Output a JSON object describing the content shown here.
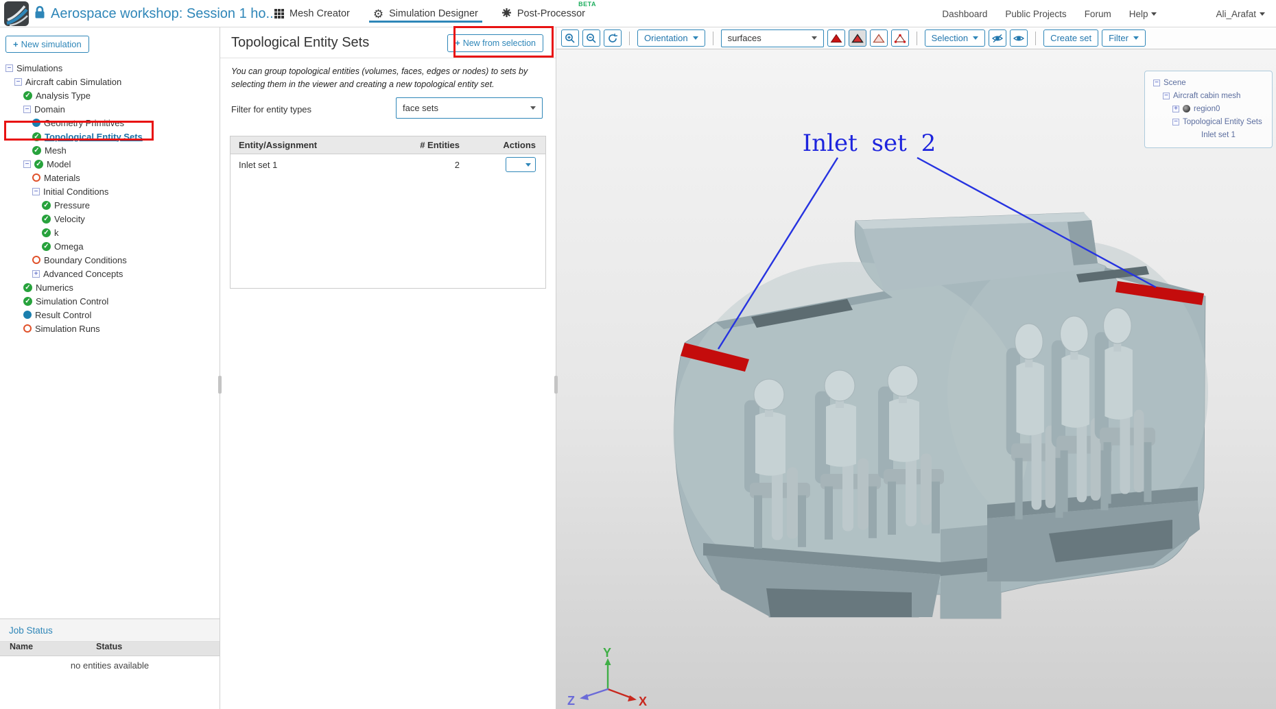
{
  "header": {
    "title": "Aerospace workshop: Session 1 ho...",
    "tabs": [
      {
        "label": "Mesh Creator"
      },
      {
        "label": "Simulation Designer"
      },
      {
        "label": "Post-Processor",
        "badge": "BETA"
      }
    ],
    "links": {
      "dashboard": "Dashboard",
      "public_projects": "Public Projects",
      "forum": "Forum",
      "help": "Help",
      "user": "Ali_Arafat"
    }
  },
  "sidebar": {
    "new_simulation": "New simulation",
    "tree": [
      {
        "label": "Simulations",
        "icon": "none",
        "twisty": "minus"
      },
      {
        "label": "Aircraft cabin Simulation",
        "icon": "none",
        "twisty": "minus"
      },
      {
        "label": "Analysis Type",
        "icon": "check",
        "twisty": "none"
      },
      {
        "label": "Domain",
        "icon": "none",
        "twisty": "minus"
      },
      {
        "label": "Geometry Primitives",
        "icon": "dot",
        "twisty": "none"
      },
      {
        "label": "Topological Entity Sets",
        "icon": "check",
        "twisty": "none"
      },
      {
        "label": "Mesh",
        "icon": "check",
        "twisty": "none"
      },
      {
        "label": "Model",
        "icon": "check",
        "twisty": "minus"
      },
      {
        "label": "Materials",
        "icon": "ring",
        "twisty": "none"
      },
      {
        "label": "Initial Conditions",
        "icon": "none",
        "twisty": "minus"
      },
      {
        "label": "Pressure",
        "icon": "check",
        "twisty": "none"
      },
      {
        "label": "Velocity",
        "icon": "check",
        "twisty": "none"
      },
      {
        "label": "k",
        "icon": "check",
        "twisty": "none"
      },
      {
        "label": "Omega",
        "icon": "check",
        "twisty": "none"
      },
      {
        "label": "Boundary Conditions",
        "icon": "ring",
        "twisty": "none"
      },
      {
        "label": "Advanced Concepts",
        "icon": "none",
        "twisty": "plus"
      },
      {
        "label": "Numerics",
        "icon": "check",
        "twisty": "none"
      },
      {
        "label": "Simulation Control",
        "icon": "check",
        "twisty": "none"
      },
      {
        "label": "Result Control",
        "icon": "dot",
        "twisty": "none"
      },
      {
        "label": "Simulation Runs",
        "icon": "ring",
        "twisty": "none"
      }
    ],
    "job_status": {
      "title": "Job Status",
      "col_name": "Name",
      "col_status": "Status",
      "empty": "no entities available"
    }
  },
  "panel": {
    "title": "Topological Entity Sets",
    "new_from_selection": "New from selection",
    "description": "You can group topological entities (volumes, faces, edges or nodes) to sets by selecting them in the viewer and creating a new topological entity set.",
    "filter_label": "Filter for entity types",
    "filter_value": "face sets",
    "table": {
      "col_entity": "Entity/Assignment",
      "col_count": "# Entities",
      "col_actions": "Actions",
      "rows": [
        {
          "name": "Inlet set 1",
          "count": "2"
        }
      ]
    }
  },
  "viewer": {
    "toolbar": {
      "orientation": "Orientation",
      "surfaces": "surfaces",
      "selection": "Selection",
      "create_set": "Create set",
      "filter": "Filter"
    },
    "scene_tree": {
      "items": [
        {
          "label": "Scene"
        },
        {
          "label": "Aircraft cabin mesh"
        },
        {
          "label": "region0"
        },
        {
          "label": "Topological Entity Sets"
        },
        {
          "label": "Inlet set 1"
        }
      ]
    },
    "annotation_label": "Inlet set 2",
    "axes": {
      "x": "X",
      "y": "Y",
      "z": "Z"
    }
  },
  "colors": {
    "accent": "#2e86b8",
    "highlight_red": "#e81212",
    "inlet_red": "#c40c0c",
    "beta_green": "#1dae5e",
    "annotation_blue": "#2633e0"
  }
}
